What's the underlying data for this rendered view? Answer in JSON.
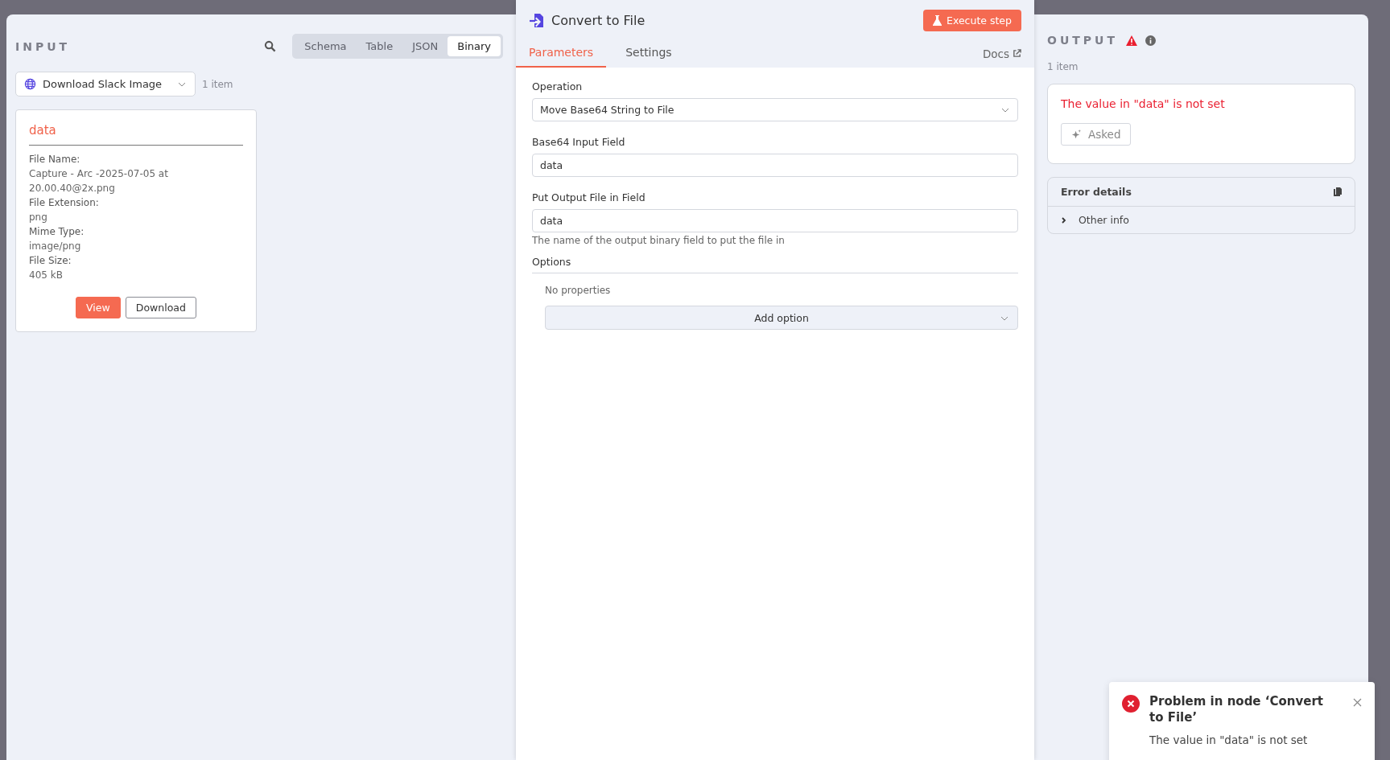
{
  "input": {
    "title": "INPUT",
    "view_tabs": [
      {
        "label": "Schema",
        "selected": false
      },
      {
        "label": "Table",
        "selected": false
      },
      {
        "label": "JSON",
        "selected": false
      },
      {
        "label": "Binary",
        "selected": true
      }
    ],
    "source_node": "Download Slack Image",
    "item_count": "1 item",
    "binary_card": {
      "title": "data",
      "fields": [
        {
          "label": "File Name:",
          "value": "Capture - Arc -2025-07-05 at 20.00.40@2x.png"
        },
        {
          "label": "File Extension:",
          "value": "png"
        },
        {
          "label": "Mime Type:",
          "value": "image/png"
        },
        {
          "label": "File Size:",
          "value": "405 kB"
        }
      ],
      "buttons": [
        {
          "label": "View",
          "kind": "primary"
        },
        {
          "label": "Download",
          "kind": "secondary"
        }
      ]
    }
  },
  "node": {
    "title": "Convert to File",
    "execute_button": "Execute step",
    "tabs": [
      {
        "label": "Parameters",
        "selected": true
      },
      {
        "label": "Settings",
        "selected": false
      }
    ],
    "docs_link": "Docs",
    "parameters": [
      {
        "label": "Operation",
        "kind": "select",
        "value": "Move Base64 String to File"
      },
      {
        "label": "Base64 Input Field",
        "kind": "text",
        "value": "data"
      },
      {
        "label": "Put Output File in Field",
        "kind": "text",
        "value": "data",
        "hint": "The name of the output binary field to put the file in"
      }
    ],
    "options": {
      "title": "Options",
      "empty_text": "No properties",
      "add_button": "Add option"
    }
  },
  "output": {
    "title": "OUTPUT",
    "item_count": "1 item",
    "error_message": "The value in \"data\" is not set",
    "ask_button": "Asked",
    "error_details": {
      "title": "Error details",
      "sections": [
        {
          "label": "Other info",
          "expanded": false
        }
      ]
    }
  },
  "toast": {
    "title": "Problem in node ‘Convert to File’",
    "message": "The value in \"data\" is not set"
  }
}
